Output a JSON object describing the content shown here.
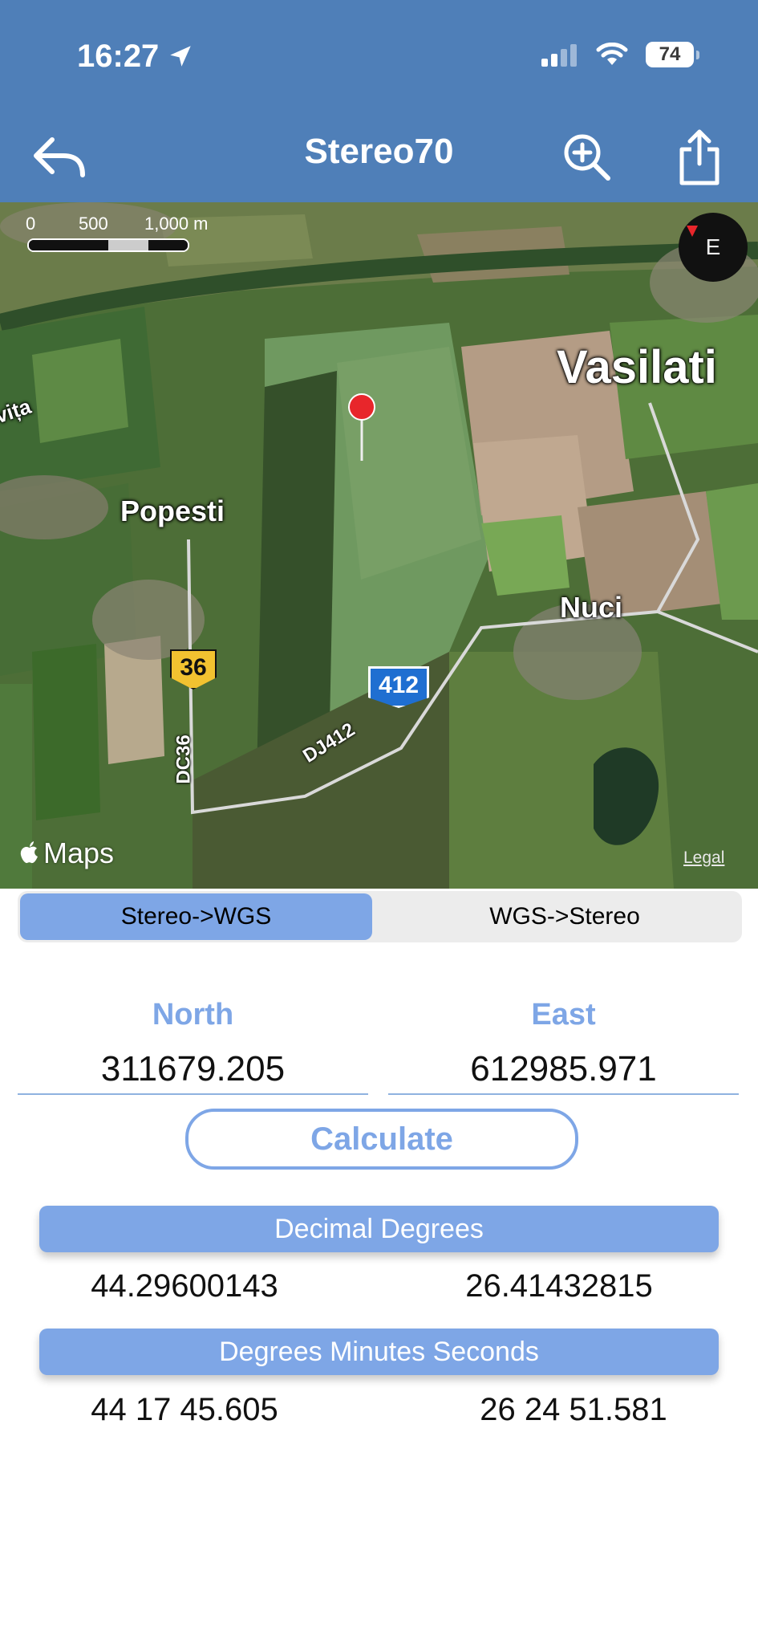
{
  "status_bar": {
    "time": "16:27",
    "battery": "74"
  },
  "nav": {
    "title": "Stereo70",
    "back_icon": "back-arrow-icon",
    "zoom_icon": "zoom-in-icon",
    "share_icon": "share-icon"
  },
  "map": {
    "scale": {
      "labels": [
        "0",
        "500",
        "1,000 m"
      ]
    },
    "compass": "E",
    "places": {
      "vasilati": "Vasilati",
      "popesti": "Popesti",
      "nuci": "Nuci",
      "vita": "vița"
    },
    "roads": {
      "dc36": "DC36",
      "dj412": "DJ412"
    },
    "shields": {
      "s36": "36",
      "s412": "412"
    },
    "attribution": "Maps",
    "legal": "Legal"
  },
  "segmented": {
    "options": [
      "Stereo->WGS",
      "WGS->Stereo"
    ],
    "selected": "Stereo->WGS"
  },
  "inputs": {
    "north_label": "North",
    "north_value": "311679.205",
    "east_label": "East",
    "east_value": "612985.971"
  },
  "calculate_label": "Calculate",
  "decimal": {
    "title": "Decimal Degrees",
    "lat": "44.29600143",
    "lon": "26.41432815"
  },
  "dms": {
    "title": "Degrees Minutes Seconds",
    "lat": "44 17 45.605",
    "lon": "26 24 51.581"
  },
  "colors": {
    "header": "#4f7fb8",
    "accent": "#7ea6e6",
    "pin": "#e8262b"
  }
}
